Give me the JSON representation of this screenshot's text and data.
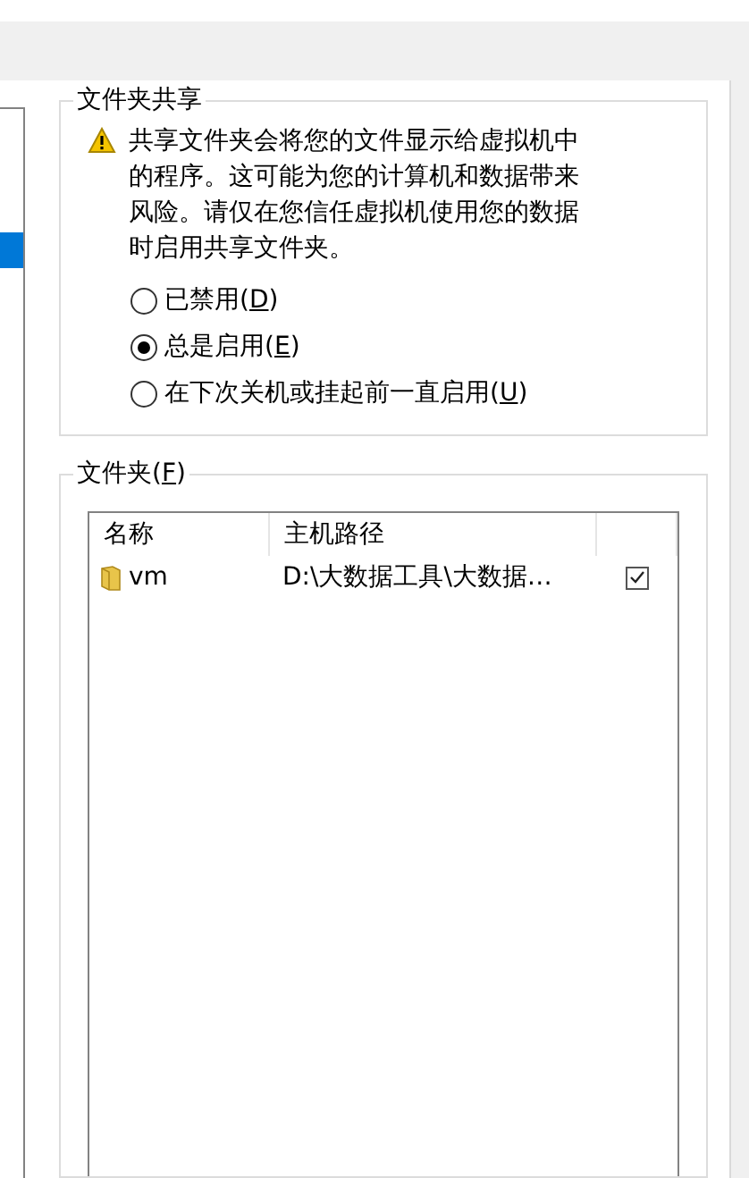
{
  "sharing": {
    "title": "文件夹共享",
    "warning": "共享文件夹会将您的文件显示给虚拟机中的程序。这可能为您的计算机和数据带来风险。请仅在您信任虚拟机使用您的数据时启用共享文件夹。",
    "options": [
      {
        "before": "已禁用(",
        "key": "D",
        "after": ")",
        "selected": false
      },
      {
        "before": "总是启用(",
        "key": "E",
        "after": ")",
        "selected": true
      },
      {
        "before": "在下次关机或挂起前一直启用(",
        "key": "U",
        "after": ")",
        "selected": false
      }
    ]
  },
  "folders": {
    "before": "文件夹(",
    "key": "F",
    "after": ")",
    "columns": [
      "名称",
      "主机路径"
    ],
    "rows": [
      {
        "name": "vm",
        "path": "D:\\大数据工具\\大数据…",
        "enabled": true
      }
    ]
  }
}
